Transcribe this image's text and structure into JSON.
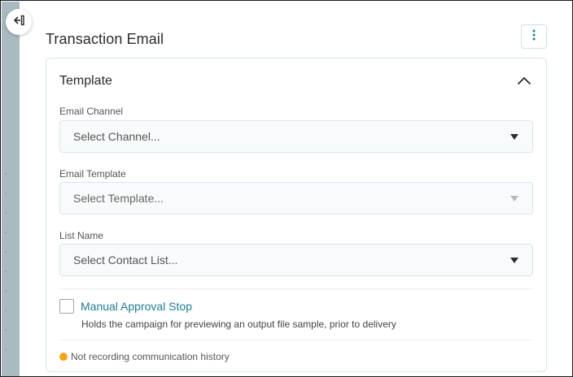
{
  "header": {
    "title": "Transaction Email"
  },
  "icons": {
    "back": "exit-arrow-icon",
    "menu": "kebab-menu-icon",
    "collapse": "chevron-up-icon",
    "caret": "caret-down-icon",
    "warning": "warning-dot-icon"
  },
  "colors": {
    "accent": "#1f7b91",
    "warning": "#f2a31b",
    "sidebar": "#a9bbc1"
  },
  "card": {
    "title": "Template",
    "fields": [
      {
        "label": "Email Channel",
        "placeholder": "Select Channel...",
        "disabled": false
      },
      {
        "label": "Email Template",
        "placeholder": "Select Template...",
        "disabled": true
      },
      {
        "label": "List Name",
        "placeholder": "Select Contact List...",
        "disabled": false
      }
    ],
    "approval": {
      "label": "Manual Approval Stop",
      "help": "Holds the campaign for previewing an output file sample, prior to delivery",
      "checked": false
    },
    "status": "Not recording communication history"
  }
}
